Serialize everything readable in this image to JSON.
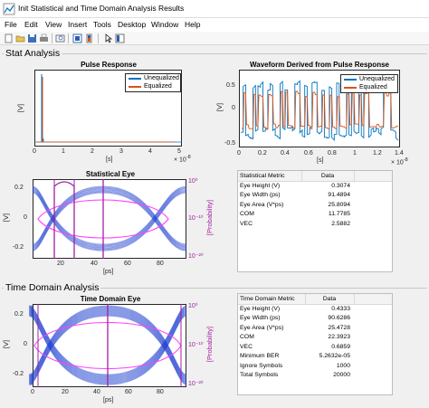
{
  "window": {
    "title": "Init Statistical and Time Domain Analysis Results"
  },
  "menu": [
    "File",
    "Edit",
    "View",
    "Insert",
    "Tools",
    "Desktop",
    "Window",
    "Help"
  ],
  "toolbar_icons": [
    "new-icon",
    "open-icon",
    "save-icon",
    "print-icon",
    "print-preview-icon",
    "link-plot-icon",
    "insert-colorbar-icon",
    "pointer-icon",
    "property-editor-icon"
  ],
  "stat_panel": {
    "title": "Stat Analysis"
  },
  "time_panel": {
    "title": "Time Domain Analysis"
  },
  "pulse": {
    "title": "Pulse Response",
    "ylabel": "[V]",
    "xlabel": "[s]",
    "exponent": "× 10",
    "exp_power": "-8",
    "xticks": [
      "0",
      "1",
      "2",
      "3",
      "4",
      "5"
    ],
    "yticks": [],
    "legend": [
      "Unequalized",
      "Equalized"
    ]
  },
  "waveform": {
    "title": "Waveform Derived from Pulse Response",
    "ylabel": "[V]",
    "xlabel": "[s]",
    "exponent": "× 10",
    "exp_power": "-8",
    "xticks": [
      "0",
      "0.2",
      "0.4",
      "0.6",
      "0.8",
      "1",
      "1.2",
      "1.4"
    ],
    "yticks": [
      "0.5",
      "0",
      "-0.5"
    ],
    "legend": [
      "Unequalized",
      "Equalized"
    ]
  },
  "stat_eye": {
    "title": "Statistical Eye",
    "ylabel": "[V]",
    "y2label": "[Probability]",
    "xlabel": "[ps]",
    "xticks": [
      "20",
      "40",
      "60",
      "80"
    ],
    "yticks": [
      "0.2",
      "0",
      "-0.2"
    ],
    "y2ticks": [
      "10⁰",
      "10⁻¹⁰",
      "10⁻²⁰"
    ]
  },
  "time_eye": {
    "title": "Time Domain Eye",
    "ylabel": "[V]",
    "y2label": "[Probability]",
    "xlabel": "[ps]",
    "xticks": [
      "0",
      "20",
      "40",
      "60",
      "80"
    ],
    "yticks": [
      "0.2",
      "0",
      "-0.2"
    ],
    "y2ticks": [
      "10⁰",
      "10⁻¹⁰",
      "10⁻²⁰"
    ]
  },
  "stat_table": {
    "headers": [
      "Statistical Metric",
      "Data"
    ],
    "rows": [
      [
        "Eye Height (V)",
        "0.3074"
      ],
      [
        "Eye Width (ps)",
        "91.4894"
      ],
      [
        "Eye Area (V*ps)",
        "25.8094"
      ],
      [
        "COM",
        "11.7785"
      ],
      [
        "VEC",
        "2.5882"
      ]
    ]
  },
  "time_table": {
    "headers": [
      "Time Domain Metric",
      "Data"
    ],
    "rows": [
      [
        "Eye Height (V)",
        "0.4333"
      ],
      [
        "Eye Width (ps)",
        "90.6286"
      ],
      [
        "Eye Area (V*ps)",
        "25.4728"
      ],
      [
        "COM",
        "22.3923"
      ],
      [
        "VEC",
        "0.6859"
      ],
      [
        "Minimum BER",
        "5.2632e-05"
      ],
      [
        "Ignore Symbols",
        "1000"
      ],
      [
        "Total Symbols",
        "20000"
      ]
    ]
  },
  "colors": {
    "unequalized": "#0072bd",
    "equalized": "#d95319",
    "marker": "#a020a0",
    "eye": "#1f3fd0"
  }
}
